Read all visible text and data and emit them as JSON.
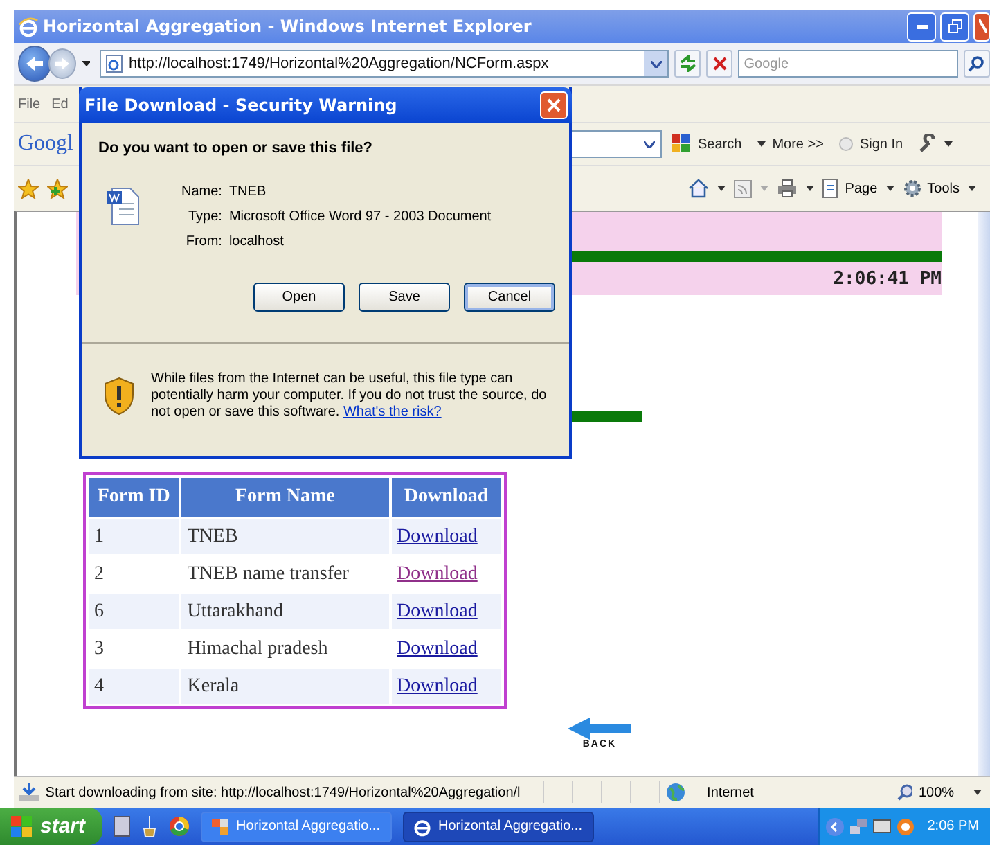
{
  "window": {
    "title": "Horizontal Aggregation - Windows Internet Explorer"
  },
  "address_bar": {
    "url": "http://localhost:1749/Horizontal%20Aggregation/NCForm.aspx"
  },
  "search_field": {
    "placeholder": "Google"
  },
  "menu": [
    "File",
    "Ed"
  ],
  "google_toolbar": {
    "logo": "Googl",
    "items": [
      "Search",
      "More >>",
      "Sign In"
    ]
  },
  "command_bar": [
    "Page",
    "Tools"
  ],
  "page": {
    "time": "2:06:41 PM",
    "table": {
      "columns": [
        "Form ID",
        "Form Name",
        "Download"
      ],
      "rows": [
        {
          "id": "1",
          "name": "TNEB",
          "link": "Download",
          "visited": false
        },
        {
          "id": "2",
          "name": "TNEB name transfer",
          "link": "Download",
          "visited": true
        },
        {
          "id": "6",
          "name": "Uttarakhand",
          "link": "Download",
          "visited": false
        },
        {
          "id": "3",
          "name": "Himachal pradesh",
          "link": "Download",
          "visited": false
        },
        {
          "id": "4",
          "name": "Kerala",
          "link": "Download",
          "visited": false
        }
      ]
    },
    "back_label": "BACK"
  },
  "dialog": {
    "title": "File Download - Security Warning",
    "question": "Do you want to open or save this file?",
    "fields": [
      {
        "label": "Name:",
        "value": "TNEB"
      },
      {
        "label": "Type:",
        "value": "Microsoft Office Word 97 - 2003 Document"
      },
      {
        "label": "From:",
        "value": "localhost"
      }
    ],
    "buttons": [
      {
        "label": "Open",
        "focused": false
      },
      {
        "label": "Save",
        "focused": false
      },
      {
        "label": "Cancel",
        "focused": true
      }
    ],
    "warning": "While files from the Internet can be useful, this file type can potentially harm your computer. If you do not trust the source, do not open or save this software.",
    "risk_link": "What's the risk?"
  },
  "status_bar": {
    "text": "Start downloading from site: http://localhost:1749/Horizontal%20Aggregation/l",
    "zone": "Internet",
    "zoom": "100%"
  },
  "taskbar": {
    "start": "start",
    "tasks": [
      {
        "label": "Horizontal Aggregatio...",
        "kind": "app",
        "selected": false
      },
      {
        "label": "Horizontal Aggregatio...",
        "kind": "browser",
        "selected": true
      }
    ],
    "clock": "2:06 PM"
  }
}
